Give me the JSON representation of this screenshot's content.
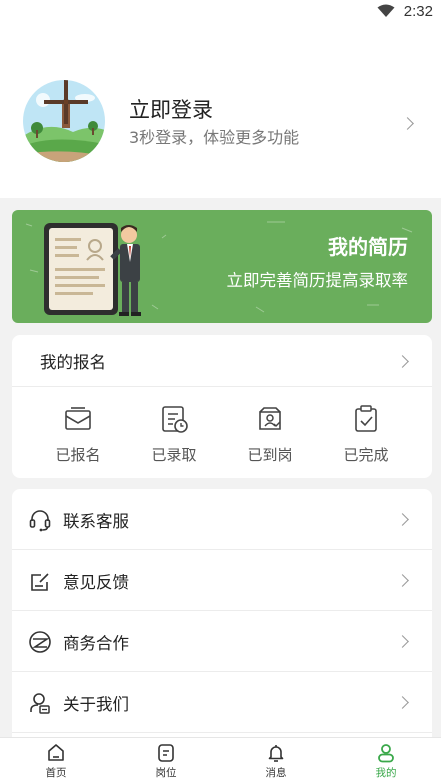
{
  "status_bar": {
    "time": "2:32"
  },
  "profile": {
    "title": "立即登录",
    "subtitle": "3秒登录，体验更多功能"
  },
  "resume_banner": {
    "title": "我的简历",
    "subtitle": "立即完善简历提高录取率"
  },
  "registration": {
    "title": "我的报名",
    "statuses": [
      {
        "label": "已报名",
        "icon": "envelope-icon"
      },
      {
        "label": "已录取",
        "icon": "clipboard-clock-icon"
      },
      {
        "label": "已到岗",
        "icon": "badge-check-icon"
      },
      {
        "label": "已完成",
        "icon": "clipboard-check-icon"
      }
    ]
  },
  "menu": [
    {
      "label": "联系客服",
      "icon": "headset-icon"
    },
    {
      "label": "意见反馈",
      "icon": "feedback-edit-icon"
    },
    {
      "label": "商务合作",
      "icon": "cooperation-icon"
    },
    {
      "label": "关于我们",
      "icon": "about-user-icon"
    }
  ],
  "tabbar": [
    {
      "label": "首页",
      "icon": "home-icon"
    },
    {
      "label": "岗位",
      "icon": "jobs-icon"
    },
    {
      "label": "消息",
      "icon": "bell-icon"
    },
    {
      "label": "我的",
      "icon": "user-icon",
      "active": true
    }
  ],
  "colors": {
    "accent": "#3aa84a",
    "banner": "#6aae5c"
  }
}
